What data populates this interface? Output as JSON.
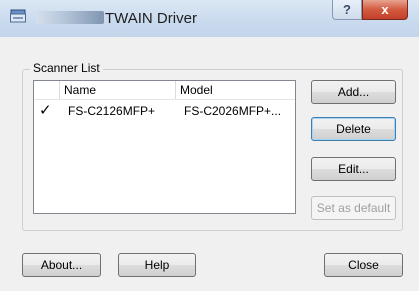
{
  "window": {
    "title": "TWAIN Driver",
    "help_glyph": "?",
    "close_glyph": "x"
  },
  "scanner_list": {
    "group_label": "Scanner List",
    "columns": [
      "Name",
      "Model"
    ],
    "rows": [
      {
        "checked": true,
        "check_glyph": "✓",
        "name": "FS-C2126MFP+",
        "model": "FS-C2026MFP+..."
      }
    ]
  },
  "side_buttons": {
    "add": "Add...",
    "delete": "Delete",
    "edit": "Edit...",
    "set_default": "Set as default"
  },
  "footer_buttons": {
    "about": "About...",
    "help": "Help",
    "close": "Close"
  },
  "icons": {
    "app": "scanner-app-icon",
    "check": "checkmark-icon"
  },
  "colors": {
    "titlebar": "#c9daee",
    "close_button": "#d35b3f",
    "focus_border": "#3c7fb1"
  }
}
